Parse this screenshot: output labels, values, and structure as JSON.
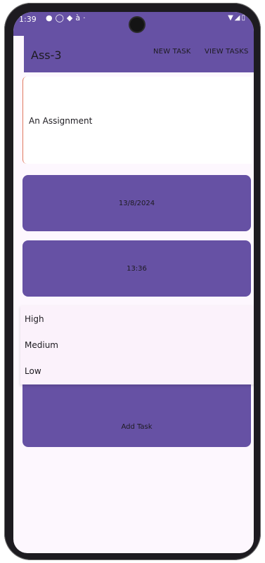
{
  "status_bar": {
    "time": "1:39",
    "left_icons": [
      "info-icon",
      "shield-icon",
      "shield-icon",
      "accessibility-icon",
      "dot-icon"
    ],
    "right_icons": [
      "wifi-icon",
      "signal-icon",
      "battery-icon"
    ]
  },
  "app_bar": {
    "title": "Ass-3",
    "actions": [
      "NEW TASK",
      "VIEW TASKS"
    ]
  },
  "form": {
    "task_name_value": "An Assignment",
    "date_button": "13/8/2024",
    "time_button": "13:36",
    "priority_options": [
      "High",
      "Medium",
      "Low"
    ],
    "add_button": "Add Task"
  },
  "colors": {
    "primary": "#6651a4",
    "surface": "#fdf7fe",
    "accent_border": "#e07a5f"
  }
}
